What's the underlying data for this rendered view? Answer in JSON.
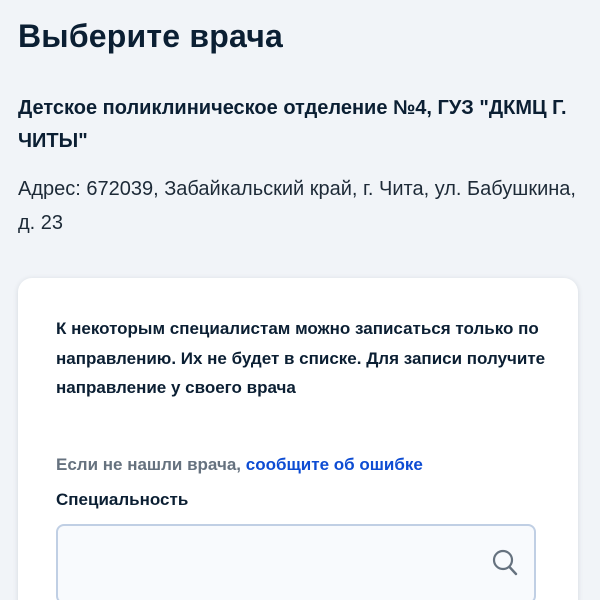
{
  "header": {
    "title": "Выберите врача"
  },
  "clinic": {
    "name": "Детское поликлиническое отделение №4, ГУЗ \"ДКМЦ Г. ЧИТЫ\"",
    "address": "Адрес: 672039, Забайкальский край, г. Чита, ул. Бабушкина, д. 23"
  },
  "card": {
    "notice": "К некоторым специалистам можно записаться только по направлению. Их не будет в списке. Для записи получите направление у своего врача",
    "hint_text": "Если не нашли врача,",
    "hint_link": "сообщите об ошибке",
    "specialty_label": "Специальность",
    "search": {
      "value": "",
      "placeholder": ""
    },
    "search_icon": "search-icon"
  },
  "colors": {
    "background": "#f1f4f8",
    "text": "#0b1f33",
    "muted": "#66727f",
    "link": "#0d4cd3",
    "field_border": "#c0cfe4"
  }
}
